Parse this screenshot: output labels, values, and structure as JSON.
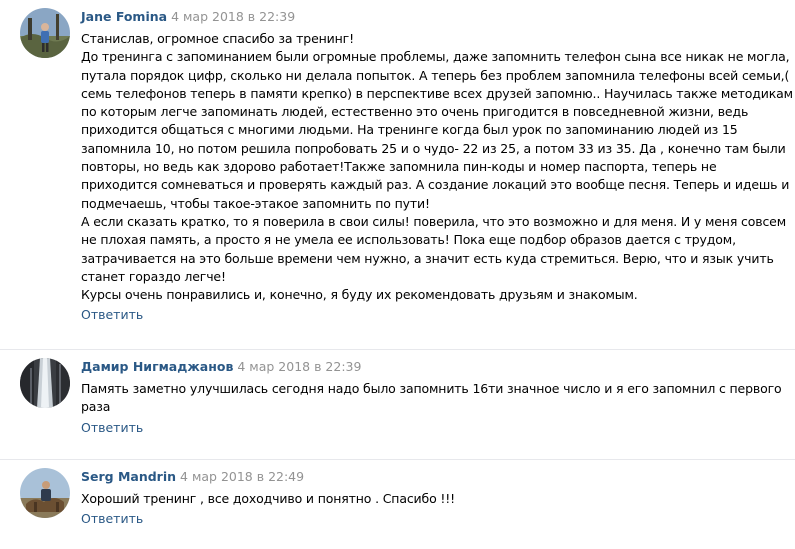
{
  "comments": [
    {
      "author": "Jane Fomina",
      "date": "4 мар 2018 в 22:39",
      "lines": [
        "Станислав, огромное спасибо за тренинг!",
        "До тренинга с запоминанием были огромные проблемы, даже запомнить телефон сына все никак не могла,",
        "путала порядок цифр, сколько ни делала попыток. А теперь без проблем запомнила телефоны всей семьи,(",
        "семь телефонов теперь в памяти крепко) в перспективе всех друзей запомню.. Научилась также методикам",
        "по которым легче запоминать людей, естественно это очень пригодится в повседневной жизни, ведь",
        "приходится общаться с многими людьми. На тренинге когда был урок по запоминанию людей из 15",
        "запомнила 10, но потом решила попробовать 25 и о чудо- 22 из 25, а потом 33 из 35. Да , конечно там были",
        "повторы, но ведь как здорово работает!Также запомнила пин-коды и номер паспорта, теперь не",
        "приходится сомневаться и проверять каждый раз. А создание локаций это вообще песня. Теперь и идешь и",
        "подмечаешь, чтобы такое-этакое запомнить по пути!",
        "А если сказать кратко, то я поверила в свои силы! поверила, что это возможно и для меня. И у меня совсем",
        "не плохая память, а просто я не умела ее использовать! Пока еще подбор образов дается с трудом,",
        "затрачивается на это больше времени чем нужно, а значит есть куда стремиться. Верю, что и язык учить",
        "станет гораздо легче!",
        "Курсы очень понравились и, конечно, я буду их рекомендовать друзьям и знакомым."
      ],
      "reply_label": "Ответить"
    },
    {
      "author": "Дамир Нигмаджанов",
      "date": "4 мар 2018 в 22:39",
      "lines": [
        "Память заметно улучшилась сегодня надо было запомнить 16ти значное число и я его запомнил с первого",
        "раза"
      ],
      "reply_label": "Ответить"
    },
    {
      "author": "Serg Mandrin",
      "date": "4 мар 2018 в 22:49",
      "lines": [
        "Хороший тренинг , все доходчиво и понятно . Спасибо !!!"
      ],
      "reply_label": "Ответить"
    }
  ],
  "colors": {
    "link": "#2a5885",
    "date": "#939393",
    "divider": "#e7e8ec"
  }
}
